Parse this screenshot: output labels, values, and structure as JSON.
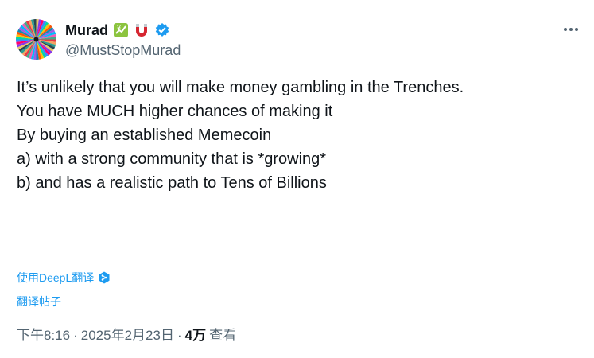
{
  "author": {
    "display_name": "Murad",
    "handle": "@MustStopMurad",
    "badges": [
      "chart-yen-emoji-icon",
      "magnet-emoji-icon",
      "verified-badge-icon"
    ]
  },
  "post": {
    "lines": [
      "It’s unlikely that you will make money gambling in the Trenches.",
      "",
      "You have MUCH higher chances of making it",
      "",
      "By buying an established Memecoin",
      "",
      "a) with a strong community that is *growing*",
      "b) and has a realistic path to Tens of Billions"
    ]
  },
  "translate": {
    "deepl_label": "使用DeepL翻译",
    "post_label": "翻译帖子"
  },
  "meta": {
    "time": "下午8:16",
    "separator": "·",
    "date": "2025年2月23日",
    "views_count": "4万",
    "views_label": "查看"
  },
  "colors": {
    "text": "#0f1419",
    "secondary": "#536471",
    "link": "#1d9bf0",
    "verified": "#1d9bf0"
  }
}
